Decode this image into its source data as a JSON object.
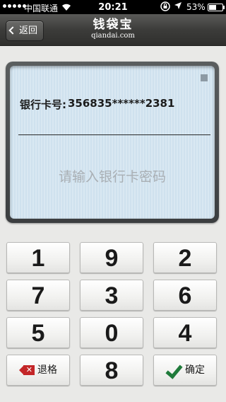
{
  "status_bar": {
    "carrier": "中国联通",
    "time": "20:21",
    "battery_percent": "53%",
    "battery_level": 0.53
  },
  "nav": {
    "back_label": "返回",
    "brand_name": "钱袋宝",
    "brand_domain": "qiandai.com"
  },
  "card": {
    "label": "银行卡号:",
    "number": "356835******2381",
    "pin_placeholder": "请输入银行卡密码"
  },
  "keypad": {
    "keys": [
      "1",
      "9",
      "2",
      "7",
      "3",
      "6",
      "5",
      "0",
      "4",
      "8"
    ],
    "backspace_label": "退格",
    "confirm_label": "确定"
  },
  "colors": {
    "backspace_red": "#c32628",
    "confirm_green": "#1f7a3a"
  }
}
